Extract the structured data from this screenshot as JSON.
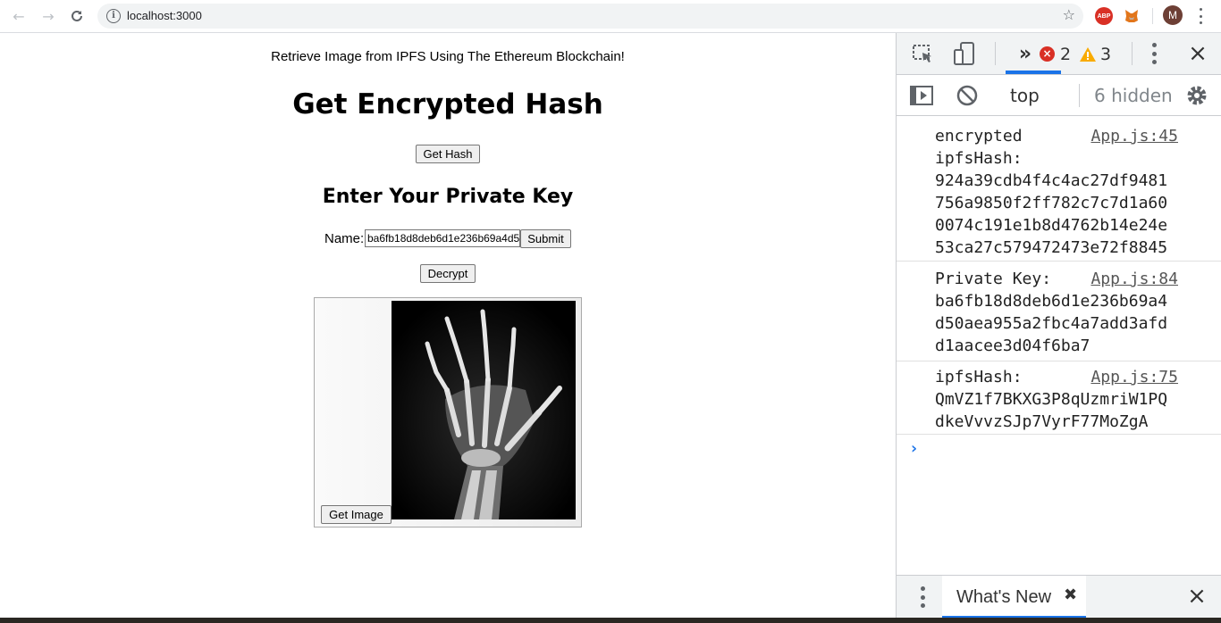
{
  "browser": {
    "url": "localhost:3000",
    "abp_label": "ABP",
    "profile_initial": "M"
  },
  "page": {
    "tagline": "Retrieve Image from IPFS Using The Ethereum Blockchain!",
    "heading": "Get Encrypted Hash",
    "get_hash_button": "Get Hash",
    "subheading": "Enter Your Private Key",
    "name_label": "Name:",
    "key_input_value": "ba6fb18d8deb6d1e236b69a4d50aea955a2fbc4a7add3afdd1aacee3d04f6ba7",
    "submit_button": "Submit",
    "decrypt_button": "Decrypt",
    "get_image_button": "Get Image"
  },
  "devtools": {
    "error_count": "2",
    "warning_count": "3",
    "context": "top",
    "hidden_label": "6 hidden",
    "messages": [
      {
        "text": "encrypted\nipfsHash:\n924a39cdb4f4c4ac27df9481\n756a9850f2ff782c7c7d1a60\n0074c191e1b8d4762b14e24e\n53ca27c579472473e72f8845",
        "source": "App.js:45"
      },
      {
        "text": "Private Key:\nba6fb18d8deb6d1e236b69a4\nd50aea955a2fbc4a7add3afd\nd1aacee3d04f6ba7",
        "source": "App.js:84"
      },
      {
        "text": "ipfsHash:\nQmVZ1f7BKXG3P8qUzmriW1PQ\ndkeVvvzSJp7VyrF77MoZgA",
        "source": "App.js:75"
      }
    ],
    "drawer_tab": "What's New"
  }
}
